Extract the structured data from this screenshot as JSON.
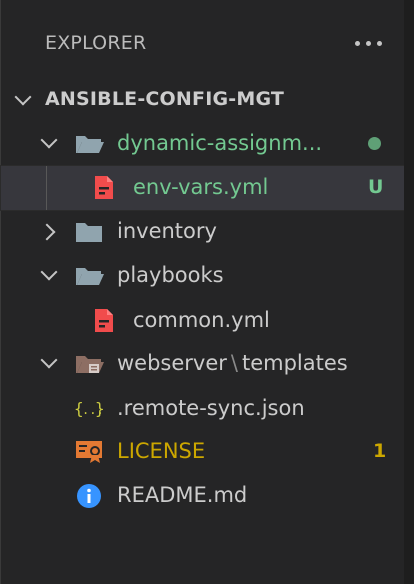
{
  "explorer": {
    "title": "EXPLORER",
    "more_actions_icon": "ellipsis-icon"
  },
  "workspace": {
    "name": "ANSIBLE-CONFIG-MGT"
  },
  "tree": {
    "dynamic": {
      "label": "dynamic-assignm...",
      "icon": "folder-open-icon",
      "status": "modified-dot"
    },
    "envvars": {
      "label": "env-vars.yml",
      "icon": "yaml-file-icon",
      "badge": "U"
    },
    "inventory": {
      "label": "inventory",
      "icon": "folder-icon"
    },
    "playbooks": {
      "label": "playbooks",
      "icon": "folder-open-icon"
    },
    "common": {
      "label": "common.yml",
      "icon": "yaml-file-icon"
    },
    "webserver": {
      "label_a": "webserver",
      "separator": "\\",
      "label_b": "templates",
      "icon": "templates-folder-icon"
    },
    "remotesync": {
      "label": ".remote-sync.json",
      "icon": "json-braces-icon"
    },
    "license": {
      "label": "LICENSE",
      "icon": "license-icon",
      "badge": "1"
    },
    "readme": {
      "label": "README.md",
      "icon": "info-icon"
    }
  },
  "colors": {
    "untracked_green": "#73c991",
    "warning_yellow": "#cca700",
    "yaml_red": "#f14c4c",
    "license_orange": "#e37933",
    "info_blue": "#3794ff",
    "json_yellow": "#cbcb41",
    "folder_gray": "#90a4ae"
  }
}
